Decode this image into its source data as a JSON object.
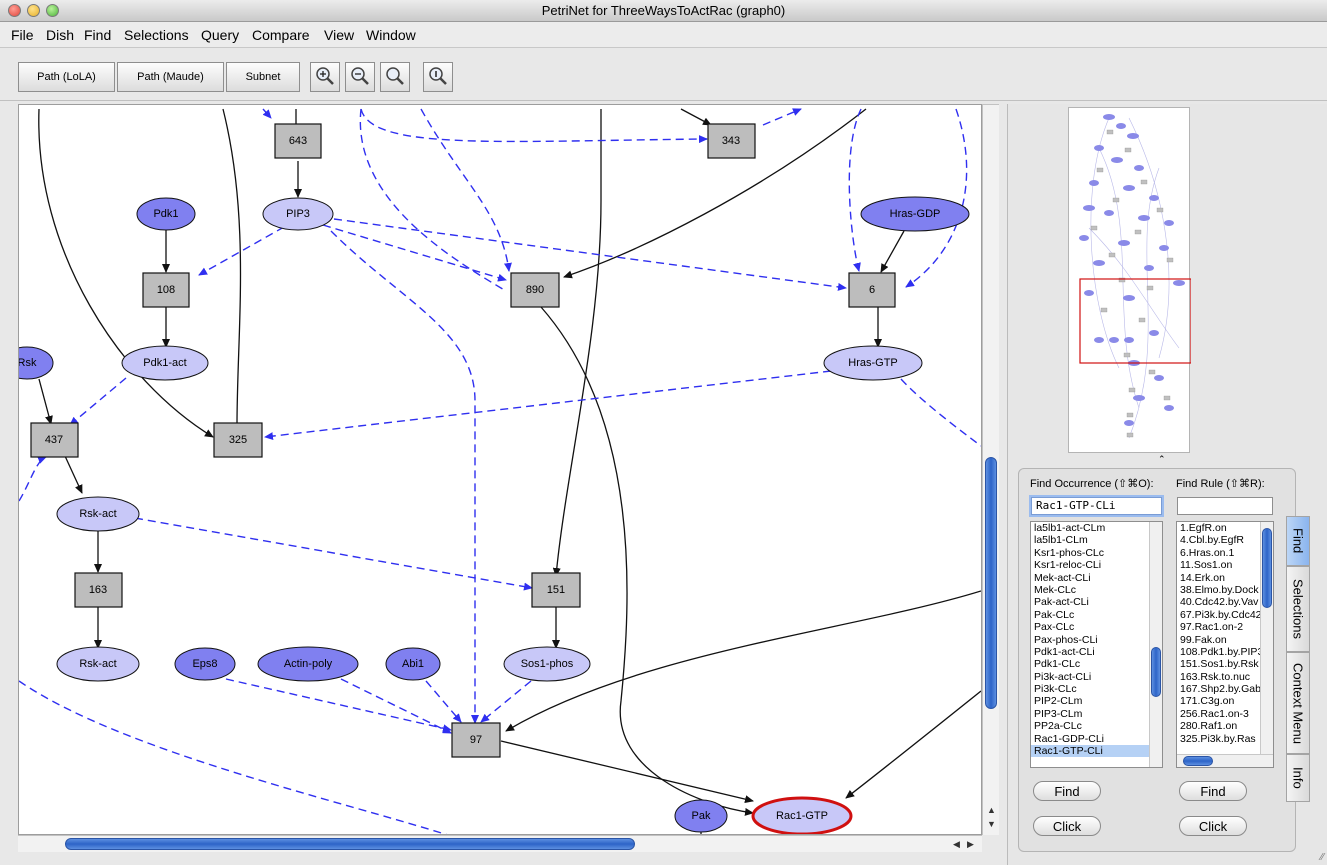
{
  "window": {
    "title": "PetriNet for ThreeWaysToActRac (graph0)"
  },
  "menu": [
    "File",
    "Dish",
    "Find",
    "Selections",
    "Query",
    "Compare",
    "View",
    "Window"
  ],
  "toolbar": {
    "path_lola": "Path (LoLA)",
    "path_maude": "Path (Maude)",
    "subnet": "Subnet"
  },
  "graph": {
    "places": [
      {
        "label": "Pdk1",
        "fill": "#8080f0"
      },
      {
        "label": "PIP3",
        "fill": "#c8c8f8"
      },
      {
        "label": "Hras-GDP",
        "fill": "#8080f0"
      },
      {
        "label": "Pdk1-act",
        "fill": "#c8c8f8"
      },
      {
        "label": "Hras-GTP",
        "fill": "#c8c8f8"
      },
      {
        "label": "Rsk",
        "fill": "#8080f0"
      },
      {
        "label": "Rsk-act",
        "fill": "#c8c8f8"
      },
      {
        "label": "Rsk-act",
        "fill": "#c8c8f8"
      },
      {
        "label": "Eps8",
        "fill": "#8080f0"
      },
      {
        "label": "Actin-poly",
        "fill": "#8080f0"
      },
      {
        "label": "Abi1",
        "fill": "#8080f0"
      },
      {
        "label": "Sos1-phos",
        "fill": "#c8c8f8"
      },
      {
        "label": "Pak",
        "fill": "#8080f0"
      },
      {
        "label": "Rac1-GTP",
        "fill": "#c8c8f8"
      }
    ],
    "transitions": [
      "643",
      "343",
      "108",
      "890",
      "6",
      "437",
      "325",
      "163",
      "151",
      "97"
    ]
  },
  "find": {
    "occurrence_label": "Find Occurrence (⇧⌘O):",
    "occurrence_value": "Rac1-GTP-CLi",
    "rule_label": "Find Rule (⇧⌘R):",
    "rule_value": "",
    "occurrences": [
      "la5lb1-act-CLm",
      "la5lb1-CLm",
      "Ksr1-phos-CLc",
      "Ksr1-reloc-CLi",
      "Mek-act-CLi",
      "Mek-CLc",
      "Pak-act-CLi",
      "Pak-CLc",
      "Pax-CLc",
      "Pax-phos-CLi",
      "Pdk1-act-CLi",
      "Pdk1-CLc",
      "Pi3k-act-CLi",
      "Pi3k-CLc",
      "PIP2-CLm",
      "PIP3-CLm",
      "PP2a-CLc",
      "Rac1-GDP-CLi",
      "Rac1-GTP-CLi"
    ],
    "selected_occurrence": "Rac1-GTP-CLi",
    "rules": [
      "1.EgfR.on",
      "4.Cbl.by.EgfR",
      "6.Hras.on.1",
      "11.Sos1.on",
      "14.Erk.on",
      "38.Elmo.by.Dock",
      "40.Cdc42.by.Vav",
      "67.Pi3k.by.Cdc42",
      "97.Rac1.on-2",
      "99.Fak.on",
      "108.Pdk1.by.PIP3",
      "151.Sos1.by.Rsk",
      "163.Rsk.to.nuc",
      "167.Shp2.by.Gab",
      "171.C3g.on",
      "256.Rac1.on-3",
      "280.Raf1.on",
      "325.Pi3k.by.Ras"
    ],
    "find_button": "Find",
    "click_button": "Click"
  },
  "tabs": [
    "Find",
    "Selections",
    "Context Menu",
    "Info"
  ],
  "active_tab": "Find",
  "colors": {
    "place_dark": "#8080f0",
    "place_light": "#c8c8f8",
    "transition": "#bdbdbd",
    "inhibit_arc": "#2f2ff0",
    "highlight": "#d01010",
    "scroll_accent": "#2d64c8"
  }
}
